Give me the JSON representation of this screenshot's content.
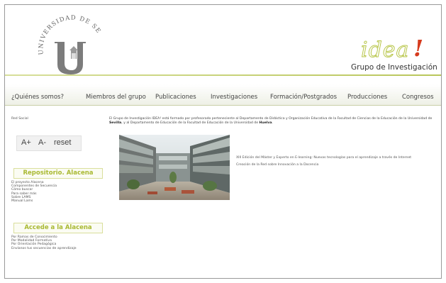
{
  "header": {
    "university_seal_text": "UNIVERSIDAD DE SEVILLA",
    "group_logo_word": "idea",
    "group_logo_mark": "!",
    "group_subtitle": "Grupo de Investigación",
    "accent_color": "#b9c65a",
    "logo_red": "#d63b1e"
  },
  "nav": {
    "items": [
      {
        "label": "¿Quiénes somos?"
      },
      {
        "label": "Miembros del grupo"
      },
      {
        "label": "Publicaciones"
      },
      {
        "label": "Investigaciones"
      },
      {
        "label": "Formación/Postgrados"
      },
      {
        "label": "Producciones"
      },
      {
        "label": "Congresos"
      }
    ]
  },
  "sidebar": {
    "red_social": "Red Social",
    "font_tools": {
      "increase": "A+",
      "decrease": "A-",
      "reset": "reset"
    },
    "repositorio": {
      "title": "Repositorio. Alacena",
      "items": [
        "El proyecto Alacena",
        "Componentes de Secuencia",
        "Cómo buscar",
        "Para saber más",
        "Sobre LAMS",
        "Manual Lams"
      ]
    },
    "accede": {
      "title": "Accede a la Alacena",
      "items": [
        "Por Ramas de Conocimiento",
        "Por Modalidad Formativa",
        "Por Orientación Pedagógica",
        "Envíanos tus secuencias de aprendizaje"
      ]
    }
  },
  "main": {
    "intro_part1": "El Grupo de Investigación IDEA! está formado por profesorado perteneciente al Departamento de Didáctica y Organización Educativa de la Facultad de Ciencias de la Educación de la",
    "intro_part2": "Universidad de ",
    "intro_sevilla": "Sevilla",
    "intro_part3": ", y al Departamento de Educación de la Facultad de Educación de la Universidad de ",
    "intro_huelva": "Huelva",
    "intro_part4": ".",
    "news": [
      "XIII Edición del Máster y Experto en E-learning: Nuevas tecnologías para el aprendizaje a través de Internet",
      "Creación de la Red sobre Innovación a la Docencia"
    ]
  }
}
